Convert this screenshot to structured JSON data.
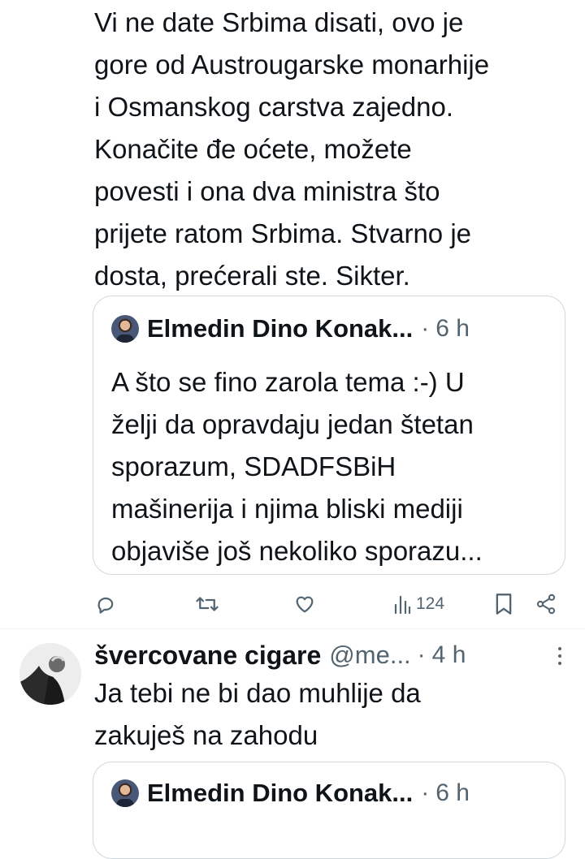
{
  "tweet": {
    "text_lines": [
      "Vi ne date Srbima disati, ovo je",
      "gore od Austrougarske monarhije",
      "i Osmanskog carstva zajedno.",
      "Konačite đe oćete, možete",
      "povesti i ona dva ministra što",
      "prijete ratom Srbima. Stvarno je",
      "dosta, prećerali ste. Sikter."
    ],
    "quote": {
      "author": "Elmedin Dino Konak...",
      "time": "6 h",
      "text_lines": [
        "A što se fino zarola tema :-) U",
        "želji da opravdaju jedan štetan",
        "sporazum, SDADFSBiH",
        "mašinerija i njima bliski mediji",
        "objaviše još nekoliko sporazu..."
      ]
    },
    "actions": {
      "reply_icon": "reply-icon",
      "retweet_icon": "retweet-icon",
      "like_icon": "heart-icon",
      "views_icon": "views-icon",
      "views_count": "124",
      "bookmark_icon": "bookmark-icon",
      "share_icon": "share-icon"
    }
  },
  "reply": {
    "author": "švercovane cigare",
    "handle": "@me...",
    "time": "4 h",
    "text_lines": [
      "Ja tebi ne bi dao muhlije da",
      "zakuješ na zahodu"
    ],
    "quote": {
      "author": "Elmedin Dino Konak...",
      "time": "6 h"
    }
  },
  "colors": {
    "text": "#0f1419",
    "secondary": "#536471",
    "border": "#cfd9de"
  }
}
